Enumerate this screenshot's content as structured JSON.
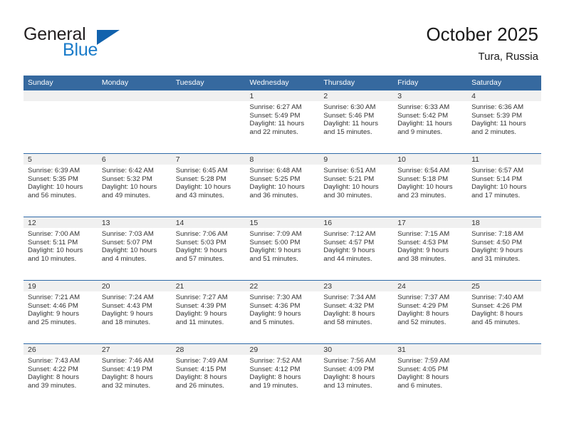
{
  "brand": {
    "word_general": "General",
    "word_blue": "Blue",
    "triangle_color": "#1162ad",
    "blue_color": "#1a7bc9"
  },
  "header": {
    "title": "October 2025",
    "subtitle": "Tura, Russia"
  },
  "theme": {
    "header_row_bg": "#36699f",
    "date_band_bg": "#f0f0f0",
    "row_divider": "#2f6aa8"
  },
  "calendar": {
    "weekday_headers": [
      "Sunday",
      "Monday",
      "Tuesday",
      "Wednesday",
      "Thursday",
      "Friday",
      "Saturday"
    ],
    "weeks": [
      [
        {
          "date": "",
          "empty": true
        },
        {
          "date": "",
          "empty": true
        },
        {
          "date": "",
          "empty": true
        },
        {
          "date": "1",
          "sunrise": "Sunrise: 6:27 AM",
          "sunset": "Sunset: 5:49 PM",
          "daylight1": "Daylight: 11 hours",
          "daylight2": "and 22 minutes."
        },
        {
          "date": "2",
          "sunrise": "Sunrise: 6:30 AM",
          "sunset": "Sunset: 5:46 PM",
          "daylight1": "Daylight: 11 hours",
          "daylight2": "and 15 minutes."
        },
        {
          "date": "3",
          "sunrise": "Sunrise: 6:33 AM",
          "sunset": "Sunset: 5:42 PM",
          "daylight1": "Daylight: 11 hours",
          "daylight2": "and 9 minutes."
        },
        {
          "date": "4",
          "sunrise": "Sunrise: 6:36 AM",
          "sunset": "Sunset: 5:39 PM",
          "daylight1": "Daylight: 11 hours",
          "daylight2": "and 2 minutes."
        }
      ],
      [
        {
          "date": "5",
          "sunrise": "Sunrise: 6:39 AM",
          "sunset": "Sunset: 5:35 PM",
          "daylight1": "Daylight: 10 hours",
          "daylight2": "and 56 minutes."
        },
        {
          "date": "6",
          "sunrise": "Sunrise: 6:42 AM",
          "sunset": "Sunset: 5:32 PM",
          "daylight1": "Daylight: 10 hours",
          "daylight2": "and 49 minutes."
        },
        {
          "date": "7",
          "sunrise": "Sunrise: 6:45 AM",
          "sunset": "Sunset: 5:28 PM",
          "daylight1": "Daylight: 10 hours",
          "daylight2": "and 43 minutes."
        },
        {
          "date": "8",
          "sunrise": "Sunrise: 6:48 AM",
          "sunset": "Sunset: 5:25 PM",
          "daylight1": "Daylight: 10 hours",
          "daylight2": "and 36 minutes."
        },
        {
          "date": "9",
          "sunrise": "Sunrise: 6:51 AM",
          "sunset": "Sunset: 5:21 PM",
          "daylight1": "Daylight: 10 hours",
          "daylight2": "and 30 minutes."
        },
        {
          "date": "10",
          "sunrise": "Sunrise: 6:54 AM",
          "sunset": "Sunset: 5:18 PM",
          "daylight1": "Daylight: 10 hours",
          "daylight2": "and 23 minutes."
        },
        {
          "date": "11",
          "sunrise": "Sunrise: 6:57 AM",
          "sunset": "Sunset: 5:14 PM",
          "daylight1": "Daylight: 10 hours",
          "daylight2": "and 17 minutes."
        }
      ],
      [
        {
          "date": "12",
          "sunrise": "Sunrise: 7:00 AM",
          "sunset": "Sunset: 5:11 PM",
          "daylight1": "Daylight: 10 hours",
          "daylight2": "and 10 minutes."
        },
        {
          "date": "13",
          "sunrise": "Sunrise: 7:03 AM",
          "sunset": "Sunset: 5:07 PM",
          "daylight1": "Daylight: 10 hours",
          "daylight2": "and 4 minutes."
        },
        {
          "date": "14",
          "sunrise": "Sunrise: 7:06 AM",
          "sunset": "Sunset: 5:03 PM",
          "daylight1": "Daylight: 9 hours",
          "daylight2": "and 57 minutes."
        },
        {
          "date": "15",
          "sunrise": "Sunrise: 7:09 AM",
          "sunset": "Sunset: 5:00 PM",
          "daylight1": "Daylight: 9 hours",
          "daylight2": "and 51 minutes."
        },
        {
          "date": "16",
          "sunrise": "Sunrise: 7:12 AM",
          "sunset": "Sunset: 4:57 PM",
          "daylight1": "Daylight: 9 hours",
          "daylight2": "and 44 minutes."
        },
        {
          "date": "17",
          "sunrise": "Sunrise: 7:15 AM",
          "sunset": "Sunset: 4:53 PM",
          "daylight1": "Daylight: 9 hours",
          "daylight2": "and 38 minutes."
        },
        {
          "date": "18",
          "sunrise": "Sunrise: 7:18 AM",
          "sunset": "Sunset: 4:50 PM",
          "daylight1": "Daylight: 9 hours",
          "daylight2": "and 31 minutes."
        }
      ],
      [
        {
          "date": "19",
          "sunrise": "Sunrise: 7:21 AM",
          "sunset": "Sunset: 4:46 PM",
          "daylight1": "Daylight: 9 hours",
          "daylight2": "and 25 minutes."
        },
        {
          "date": "20",
          "sunrise": "Sunrise: 7:24 AM",
          "sunset": "Sunset: 4:43 PM",
          "daylight1": "Daylight: 9 hours",
          "daylight2": "and 18 minutes."
        },
        {
          "date": "21",
          "sunrise": "Sunrise: 7:27 AM",
          "sunset": "Sunset: 4:39 PM",
          "daylight1": "Daylight: 9 hours",
          "daylight2": "and 11 minutes."
        },
        {
          "date": "22",
          "sunrise": "Sunrise: 7:30 AM",
          "sunset": "Sunset: 4:36 PM",
          "daylight1": "Daylight: 9 hours",
          "daylight2": "and 5 minutes."
        },
        {
          "date": "23",
          "sunrise": "Sunrise: 7:34 AM",
          "sunset": "Sunset: 4:32 PM",
          "daylight1": "Daylight: 8 hours",
          "daylight2": "and 58 minutes."
        },
        {
          "date": "24",
          "sunrise": "Sunrise: 7:37 AM",
          "sunset": "Sunset: 4:29 PM",
          "daylight1": "Daylight: 8 hours",
          "daylight2": "and 52 minutes."
        },
        {
          "date": "25",
          "sunrise": "Sunrise: 7:40 AM",
          "sunset": "Sunset: 4:26 PM",
          "daylight1": "Daylight: 8 hours",
          "daylight2": "and 45 minutes."
        }
      ],
      [
        {
          "date": "26",
          "sunrise": "Sunrise: 7:43 AM",
          "sunset": "Sunset: 4:22 PM",
          "daylight1": "Daylight: 8 hours",
          "daylight2": "and 39 minutes."
        },
        {
          "date": "27",
          "sunrise": "Sunrise: 7:46 AM",
          "sunset": "Sunset: 4:19 PM",
          "daylight1": "Daylight: 8 hours",
          "daylight2": "and 32 minutes."
        },
        {
          "date": "28",
          "sunrise": "Sunrise: 7:49 AM",
          "sunset": "Sunset: 4:15 PM",
          "daylight1": "Daylight: 8 hours",
          "daylight2": "and 26 minutes."
        },
        {
          "date": "29",
          "sunrise": "Sunrise: 7:52 AM",
          "sunset": "Sunset: 4:12 PM",
          "daylight1": "Daylight: 8 hours",
          "daylight2": "and 19 minutes."
        },
        {
          "date": "30",
          "sunrise": "Sunrise: 7:56 AM",
          "sunset": "Sunset: 4:09 PM",
          "daylight1": "Daylight: 8 hours",
          "daylight2": "and 13 minutes."
        },
        {
          "date": "31",
          "sunrise": "Sunrise: 7:59 AM",
          "sunset": "Sunset: 4:05 PM",
          "daylight1": "Daylight: 8 hours",
          "daylight2": "and 6 minutes."
        },
        {
          "date": "",
          "empty": true
        }
      ]
    ]
  }
}
